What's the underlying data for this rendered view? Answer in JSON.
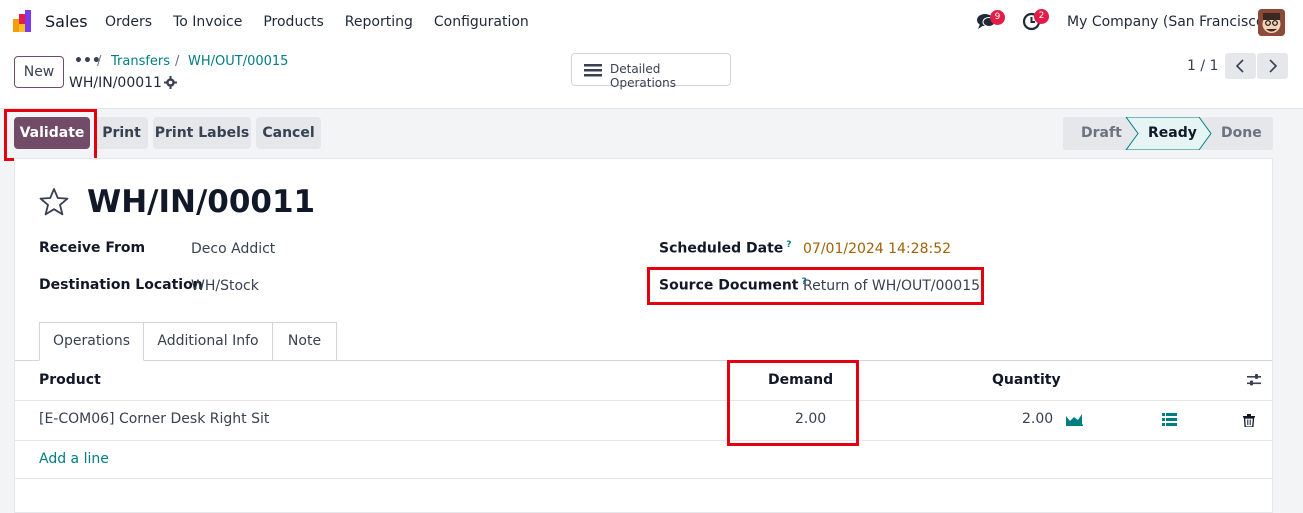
{
  "navbar": {
    "app_name": "Sales",
    "menu": [
      "Orders",
      "To Invoice",
      "Products",
      "Reporting",
      "Configuration"
    ],
    "chat_badge": "9",
    "activity_badge": "2",
    "company": "My Company (San Francisco)"
  },
  "control_panel": {
    "new_label": "New",
    "breadcrumb_dots": "•••",
    "breadcrumb": [
      "Transfers",
      "WH/OUT/00015"
    ],
    "current_record": "WH/IN/00011",
    "detailed_ops_label": "Detailed Operations",
    "pager": "1 / 1"
  },
  "actions": {
    "validate": "Validate",
    "print": "Print",
    "print_labels": "Print Labels",
    "cancel": "Cancel"
  },
  "status": {
    "steps": [
      "Draft",
      "Ready",
      "Done"
    ],
    "current": "Ready"
  },
  "record": {
    "title": "WH/IN/00011",
    "receive_from_label": "Receive From",
    "receive_from": "Deco Addict",
    "destination_label": "Destination Location",
    "destination": "WH/Stock",
    "scheduled_date_label": "Scheduled Date",
    "scheduled_date": "07/01/2024 14:28:52",
    "source_document_label": "Source Document",
    "source_document": "Return of WH/OUT/00015",
    "help_mark": "?"
  },
  "tabs": [
    "Operations",
    "Additional Info",
    "Note"
  ],
  "table": {
    "headers": {
      "product": "Product",
      "demand": "Demand",
      "quantity": "Quantity"
    },
    "rows": [
      {
        "product": "[E-COM06] Corner Desk Right Sit",
        "demand": "2.00",
        "quantity": "2.00"
      }
    ],
    "add_line": "Add a line"
  },
  "colors": {
    "primary": "#714b67",
    "link": "#017e84",
    "highlight": "#e3000f",
    "badge": "#e11d48"
  }
}
